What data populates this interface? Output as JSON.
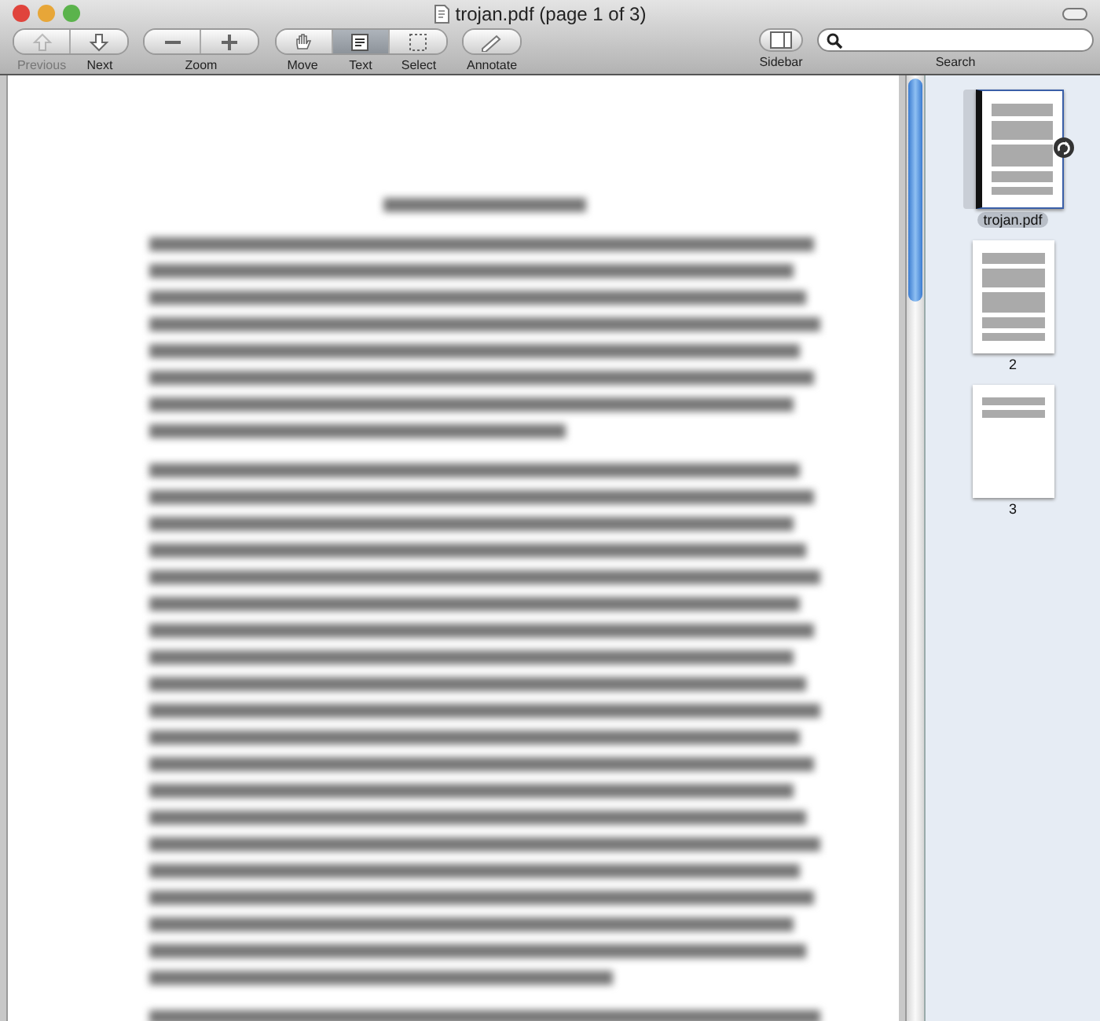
{
  "window": {
    "title": "trojan.pdf (page 1 of 3)"
  },
  "toolbar": {
    "groups": [
      {
        "buttons": [
          {
            "kind": "up",
            "label": "Previous",
            "disabled": true,
            "selected": false
          },
          {
            "kind": "down",
            "label": "Next",
            "disabled": false,
            "selected": false
          }
        ]
      },
      {
        "label": "Zoom",
        "buttons": [
          {
            "kind": "minus",
            "disabled": false,
            "selected": false
          },
          {
            "kind": "plus",
            "disabled": false,
            "selected": false
          }
        ]
      },
      {
        "buttons": [
          {
            "kind": "hand",
            "label": "Move",
            "disabled": false,
            "selected": false
          },
          {
            "kind": "text",
            "label": "Text",
            "disabled": false,
            "selected": true
          },
          {
            "kind": "select",
            "label": "Select",
            "disabled": false,
            "selected": false
          }
        ]
      },
      {
        "buttons": [
          {
            "kind": "pencil",
            "label": "Annotate",
            "disabled": false,
            "selected": false
          }
        ]
      }
    ],
    "sidebar_button": {
      "label": "Sidebar"
    },
    "search": {
      "label": "Search"
    }
  },
  "sidebar": {
    "thumbnails": [
      {
        "label": "trojan.pdf",
        "selected": true,
        "kind": "full"
      },
      {
        "label": "2",
        "selected": false,
        "kind": "full"
      },
      {
        "label": "3",
        "selected": false,
        "kind": "short"
      }
    ]
  }
}
